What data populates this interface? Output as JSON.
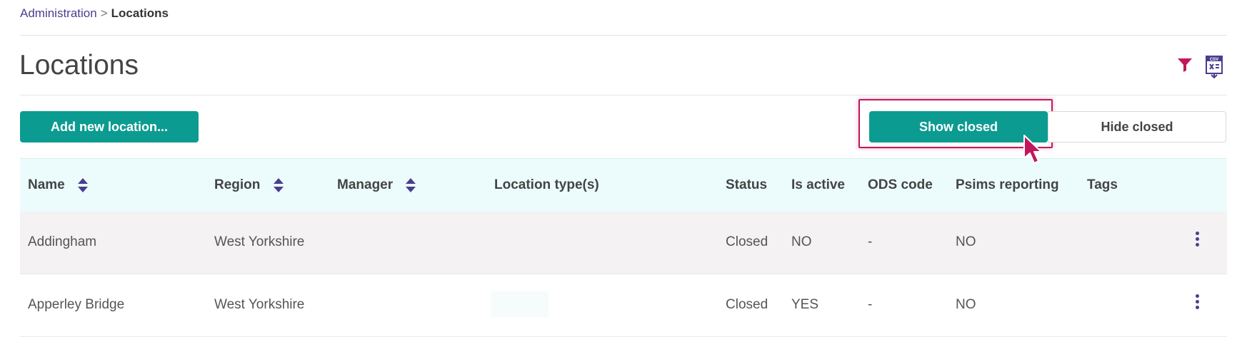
{
  "breadcrumb": {
    "parent": "Administration",
    "separator": ">",
    "current": "Locations"
  },
  "page": {
    "title": "Locations"
  },
  "toolbar": {
    "filter_icon": "filter-icon",
    "csv_icon": "csv-export-icon",
    "add_label": "Add new location...",
    "show_closed_label": "Show closed",
    "hide_closed_label": "Hide closed"
  },
  "colors": {
    "accent": "#0c9b91",
    "brand_purple": "#4a3d8f",
    "highlight": "#c2185b",
    "header_bg": "#ecfcfc"
  },
  "table": {
    "headers": {
      "name": "Name",
      "region": "Region",
      "manager": "Manager",
      "location_types": "Location type(s)",
      "status": "Status",
      "is_active": "Is active",
      "ods_code": "ODS code",
      "psims": "Psims reporting",
      "tags": "Tags"
    },
    "rows": [
      {
        "name": "Addingham",
        "region": "West Yorkshire",
        "manager": "",
        "location_types": "",
        "status": "Closed",
        "is_active": "NO",
        "ods_code": "-",
        "psims": "NO",
        "tags": ""
      },
      {
        "name": "Apperley Bridge",
        "region": "West Yorkshire",
        "manager": "",
        "location_types": "",
        "status": "Closed",
        "is_active": "YES",
        "ods_code": "-",
        "psims": "NO",
        "tags": ""
      }
    ]
  }
}
